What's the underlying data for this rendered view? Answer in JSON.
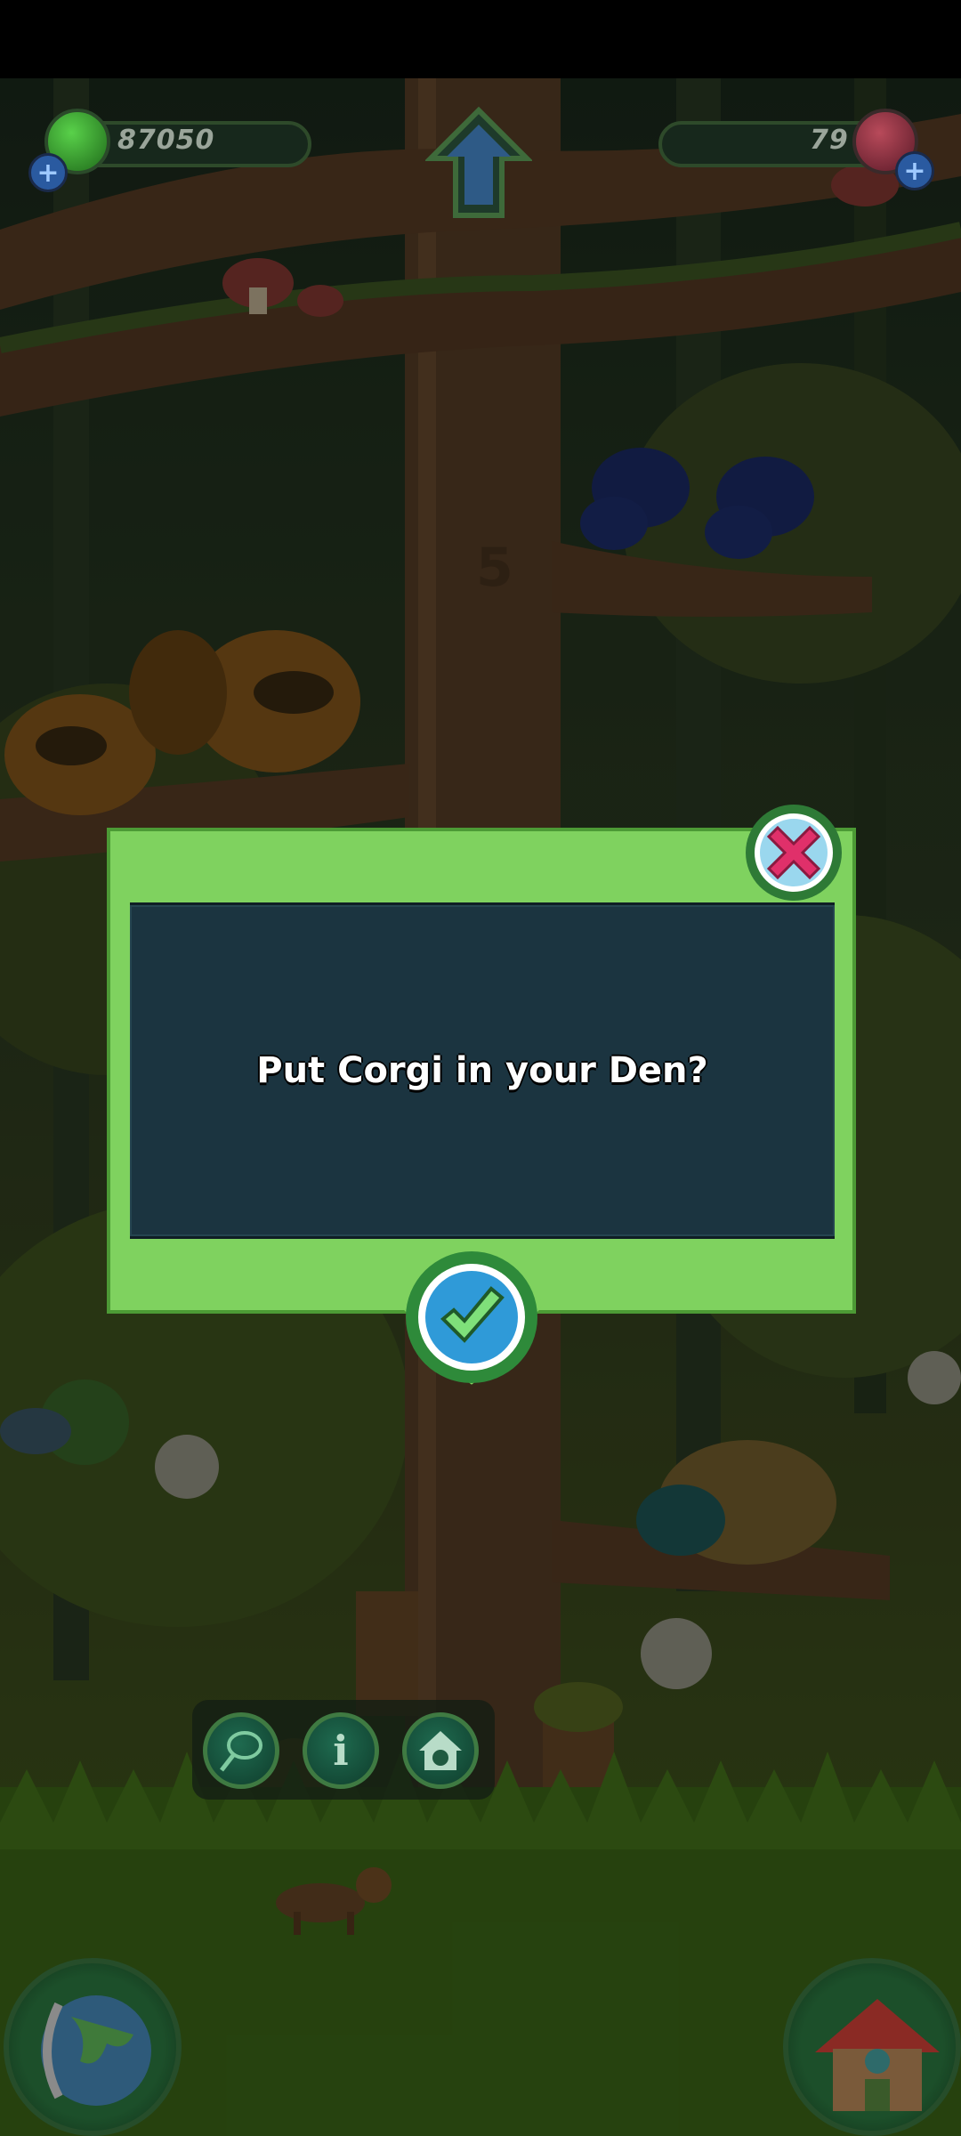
{
  "hud": {
    "coins": "87050",
    "gems": "79"
  },
  "tree": {
    "level_mark": "5"
  },
  "dialog": {
    "message": "Put Corgi in your Den?"
  },
  "icons": {
    "coin": "green-coin-icon",
    "gem": "red-gem-icon",
    "add": "plus-icon",
    "home": "home-arrow-icon",
    "close": "close-x-icon",
    "confirm": "checkmark-icon",
    "net": "net-icon",
    "info": "info-icon",
    "den": "den-icon",
    "world": "globe-icon",
    "house": "house-icon"
  },
  "colors": {
    "dialog_frame": "#7fd25f",
    "dialog_panel": "#1b3440",
    "close_accent": "#e0306a",
    "confirm_accent": "#2f9ad8"
  }
}
